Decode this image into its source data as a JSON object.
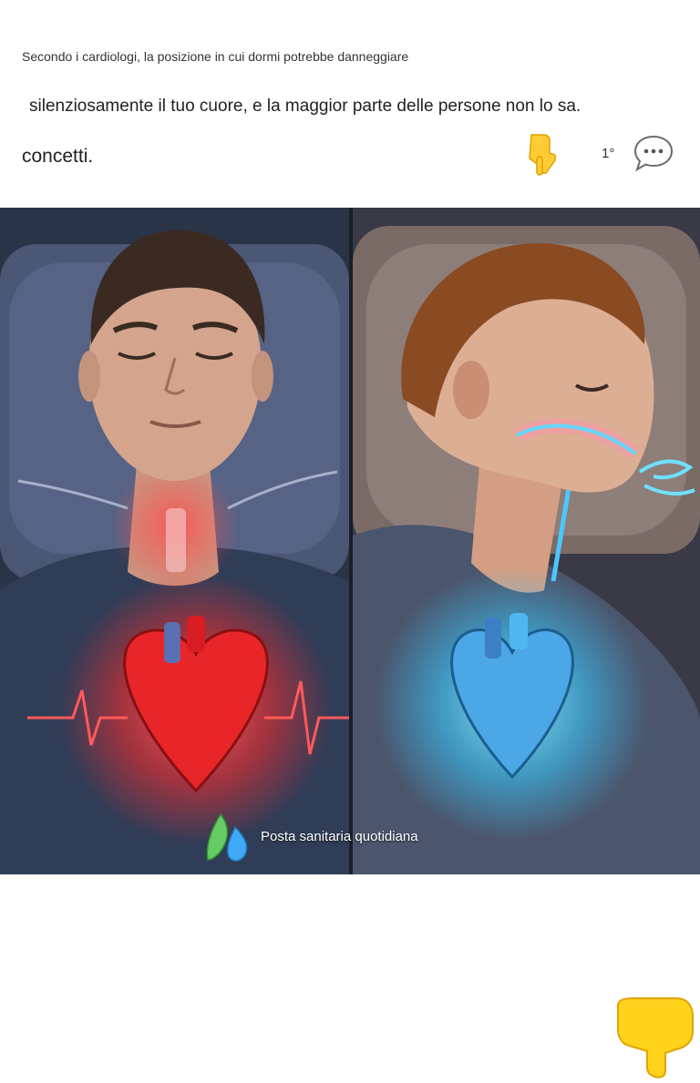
{
  "post": {
    "line1": "Secondo i cardiologi, la posizione in cui dormi potrebbe danneggiare",
    "line2": "silenziosamente il tuo cuore, e la maggior parte delle persone non lo sa.",
    "line3": "concetti.",
    "reaction_count": "1°",
    "comment_icon": "speech-bubble-ellipsis-icon",
    "pointing_icon": "backhand-index-pointing-down-icon"
  },
  "image": {
    "watermark_text": "Posta sanitaria quotidiana",
    "watermark_icon": "leaf-drop-logo-icon"
  },
  "colors": {
    "left_panel_glow": "#ff2b2b",
    "right_panel_glow": "#36c9ff",
    "header_bg": "#ffffff",
    "emoji_yellow": "#ffd21c"
  }
}
